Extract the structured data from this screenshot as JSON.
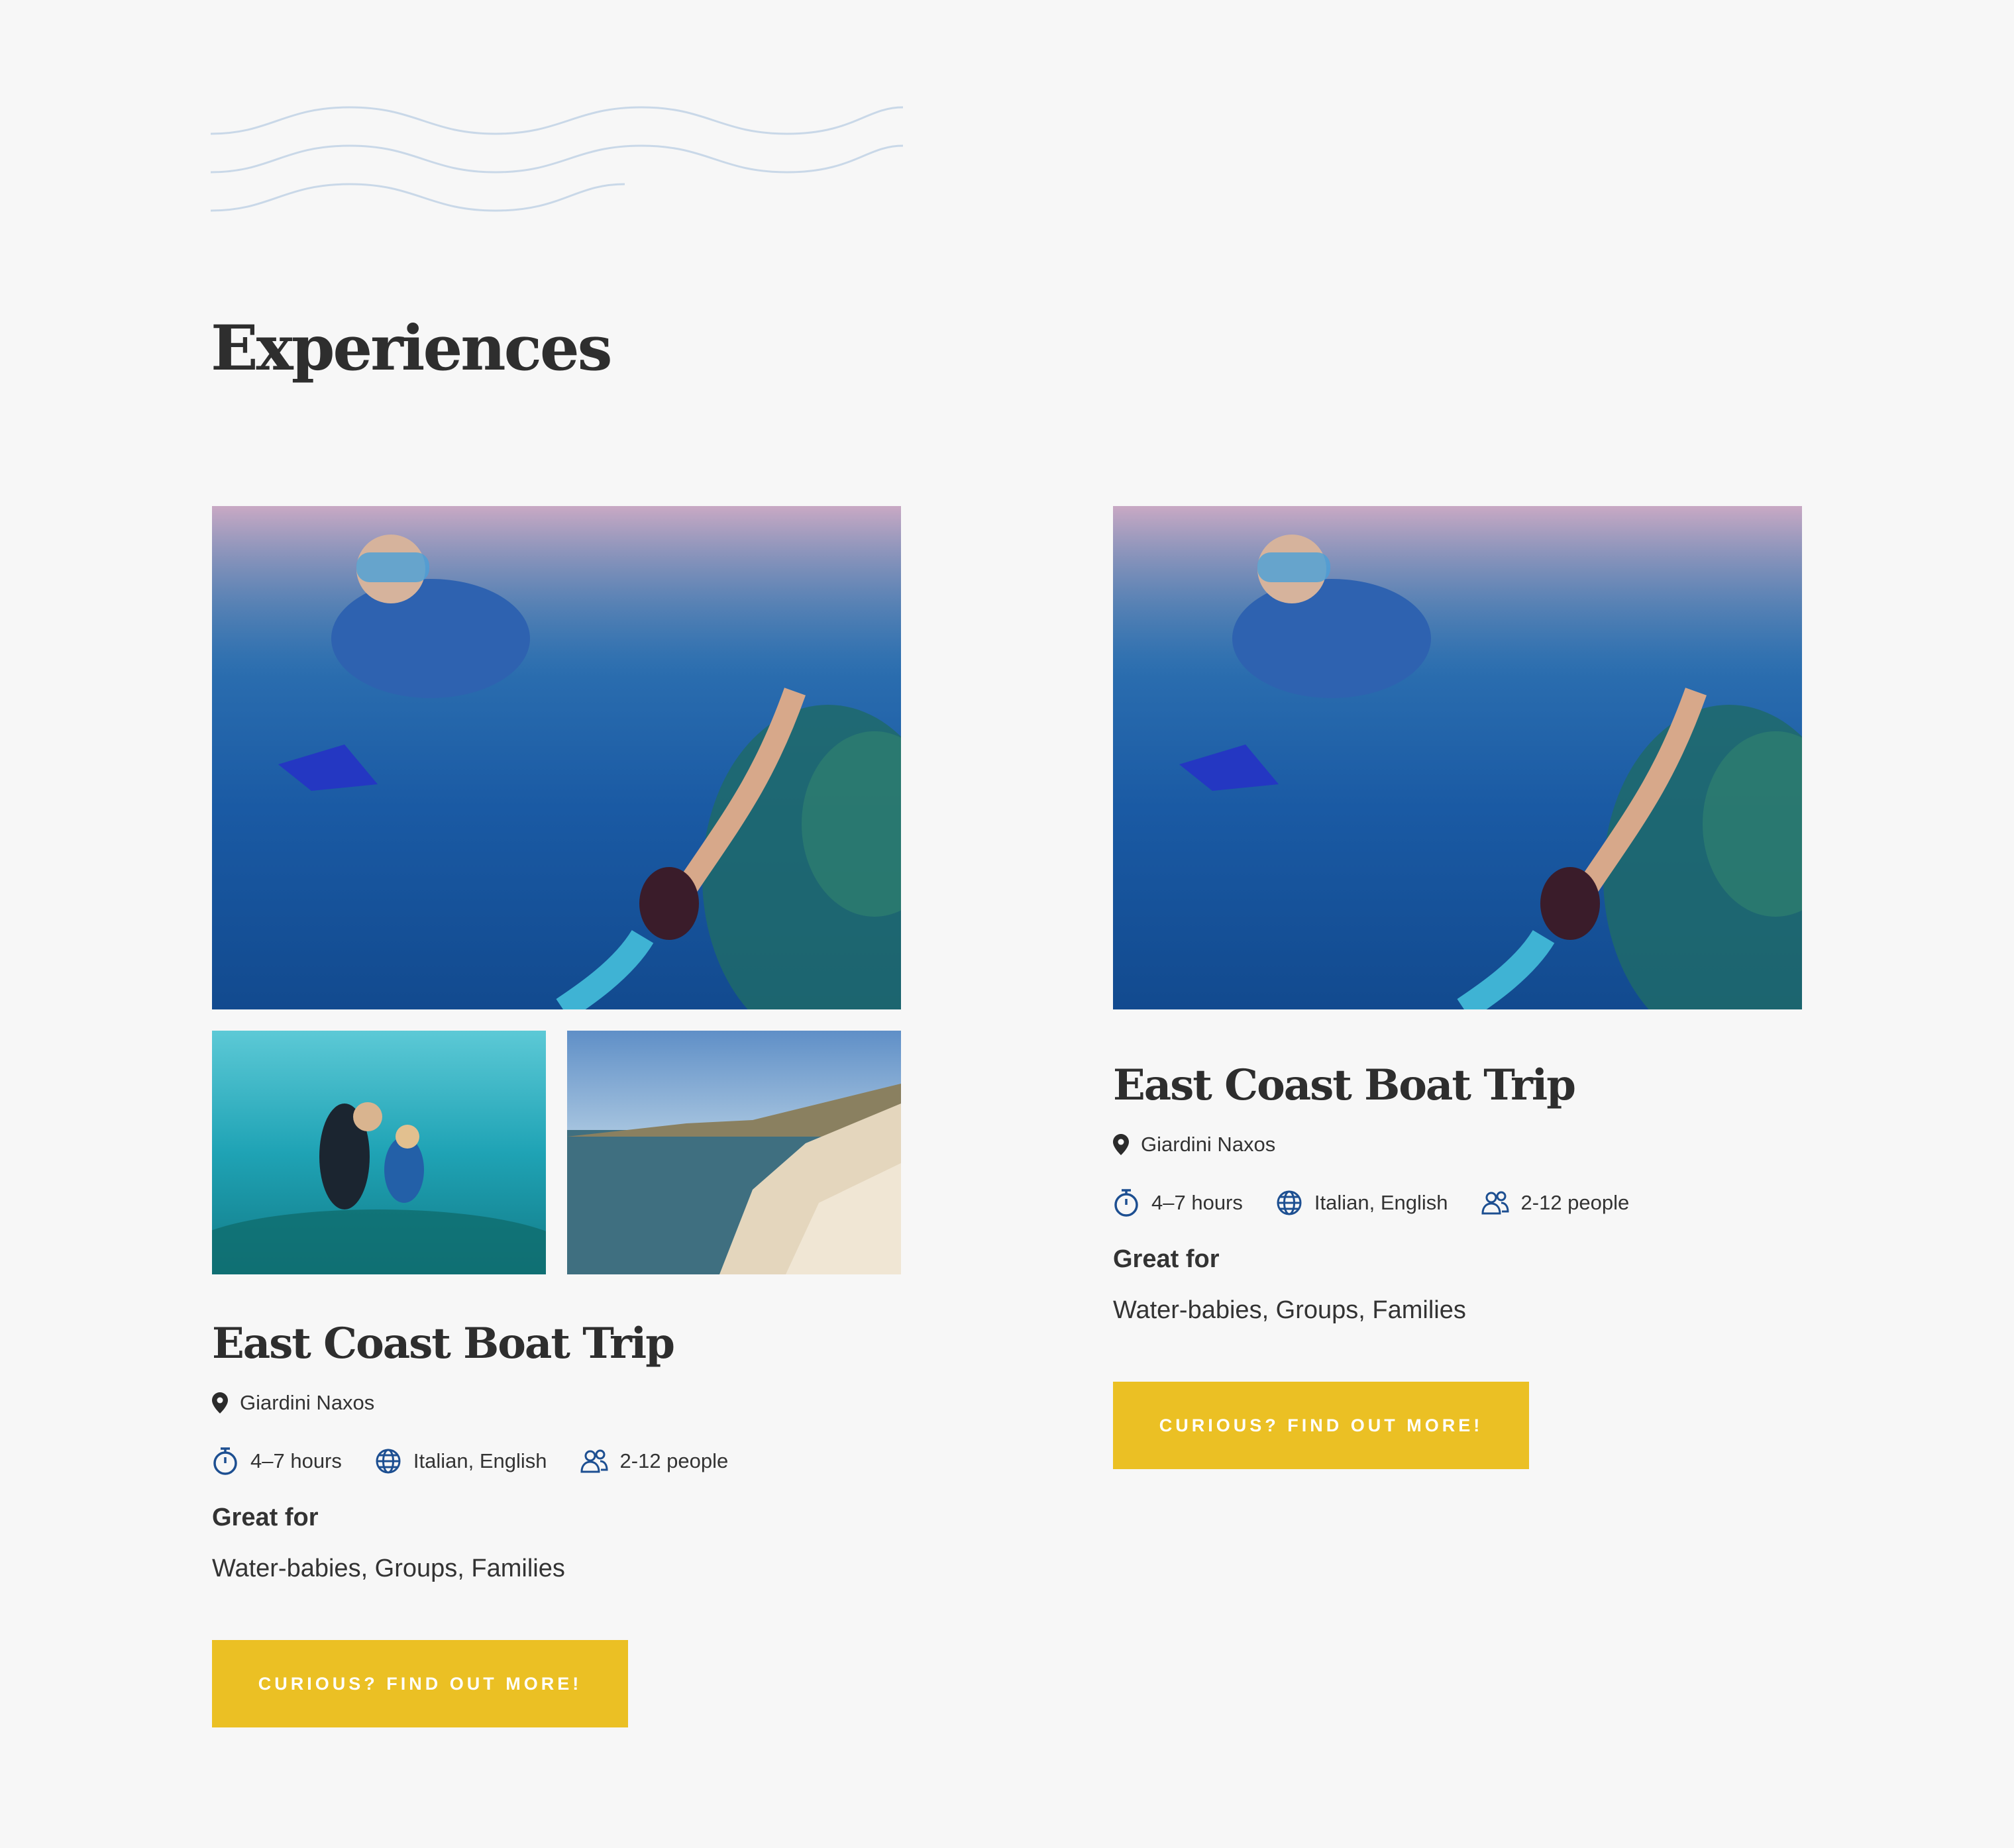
{
  "section": {
    "title": "Experiences"
  },
  "colors": {
    "background": "#f7f7f7",
    "wave": "#c9d8e8",
    "accent_button": "#ebc024",
    "icon_blue": "#1d4f91",
    "text": "#2e2e2e"
  },
  "cards": [
    {
      "title": "East Coast Boat Trip",
      "location": "Giardini Naxos",
      "duration": "4–7 hours",
      "languages": "Italian, English",
      "group_size": "2-12 people",
      "great_for_label": "Great for",
      "great_for_value": "Water-babies, Groups, Families",
      "cta_label": "CURIOUS? FIND OUT MORE!",
      "icons": [
        "map-pin-icon",
        "stopwatch-icon",
        "globe-icon",
        "people-icon"
      ]
    },
    {
      "title": "East Coast Boat Trip",
      "location": "Giardini Naxos",
      "duration": "4–7 hours",
      "languages": "Italian, English",
      "group_size": "2-12 people",
      "great_for_label": "Great for",
      "great_for_value": "Water-babies, Groups, Families",
      "cta_label": "CURIOUS? FIND OUT MORE!",
      "icons": [
        "map-pin-icon",
        "stopwatch-icon",
        "globe-icon",
        "people-icon"
      ]
    }
  ]
}
